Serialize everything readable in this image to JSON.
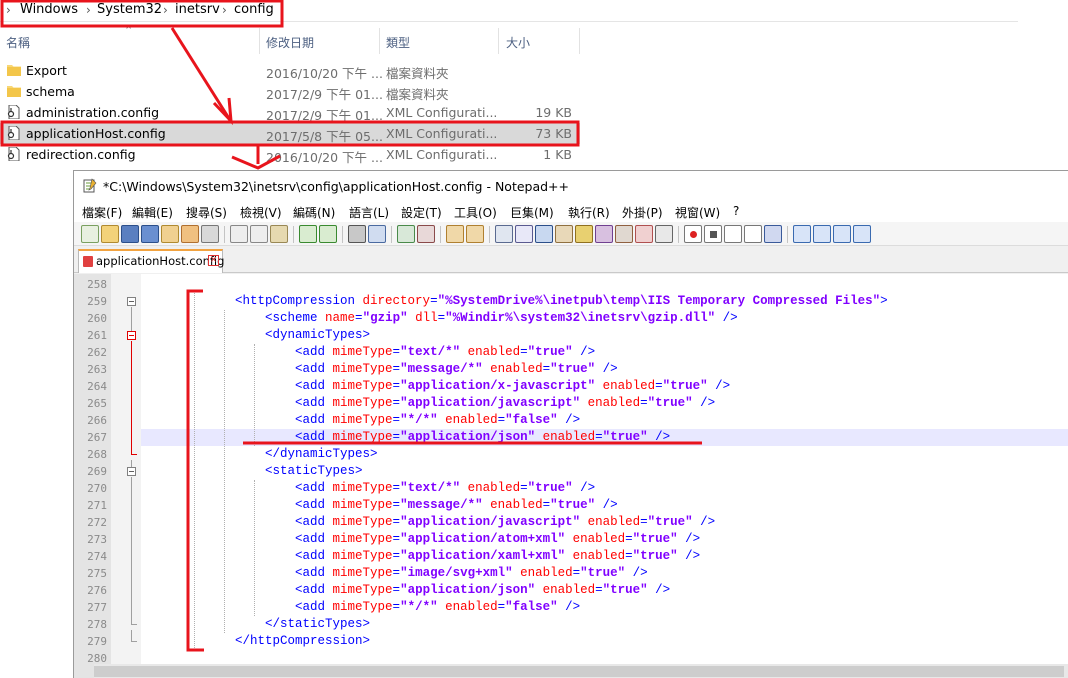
{
  "explorer": {
    "breadcrumb": [
      "Windows",
      "System32",
      "inetsrv",
      "config"
    ],
    "columns": {
      "name": "名稱",
      "date": "修改日期",
      "type": "類型",
      "size": "大小"
    },
    "files": [
      {
        "name": "Export",
        "date": "2016/10/20 下午 ...",
        "type": "檔案資料夾",
        "size": "",
        "icon": "folder-icon"
      },
      {
        "name": "schema",
        "date": "2017/2/9 下午 01...",
        "type": "檔案資料夾",
        "size": "",
        "icon": "folder-icon"
      },
      {
        "name": "administration.config",
        "date": "2017/2/9 下午 01...",
        "type": "XML Configurati...",
        "size": "19 KB",
        "icon": "config-file-icon"
      },
      {
        "name": "applicationHost.config",
        "date": "2017/5/8 下午 05...",
        "type": "XML Configurati...",
        "size": "73 KB",
        "icon": "config-file-icon",
        "selected": true
      },
      {
        "name": "redirection.config",
        "date": "2016/10/20 下午 ...",
        "type": "XML Configurati...",
        "size": "1 KB",
        "icon": "config-file-icon"
      }
    ]
  },
  "notepad": {
    "title": "*C:\\Windows\\System32\\inetsrv\\config\\applicationHost.config - Notepad++",
    "menu": [
      "檔案(F)",
      "編輯(E)",
      "搜尋(S)",
      "檢視(V)",
      "編碼(N)",
      "語言(L)",
      "設定(T)",
      "工具(O)",
      "巨集(M)",
      "執行(R)",
      "外掛(P)",
      "視窗(W)",
      "?"
    ],
    "tab": {
      "label": "applicationHost.config",
      "close": "☒"
    },
    "lines": [
      {
        "n": "258",
        "indent": "",
        "parts": []
      },
      {
        "n": "259",
        "indent": "    ",
        "parts": [
          [
            "t",
            "<httpCompression "
          ],
          [
            "a",
            "directory"
          ],
          [
            "t",
            "="
          ],
          [
            "v",
            "\"%SystemDrive%\\inetpub\\temp\\IIS Temporary Compressed Files\""
          ],
          [
            "t",
            ">"
          ]
        ]
      },
      {
        "n": "260",
        "indent": "        ",
        "parts": [
          [
            "t",
            "<scheme "
          ],
          [
            "a",
            "name"
          ],
          [
            "t",
            "="
          ],
          [
            "v",
            "\"gzip\""
          ],
          [
            "t",
            " "
          ],
          [
            "a",
            "dll"
          ],
          [
            "t",
            "="
          ],
          [
            "v",
            "\"%Windir%\\system32\\inetsrv\\gzip.dll\""
          ],
          [
            "t",
            " />"
          ]
        ]
      },
      {
        "n": "261",
        "indent": "        ",
        "parts": [
          [
            "t",
            "<dynamicTypes>"
          ]
        ]
      },
      {
        "n": "262",
        "indent": "            ",
        "parts": [
          [
            "t",
            "<add "
          ],
          [
            "a",
            "mimeType"
          ],
          [
            "t",
            "="
          ],
          [
            "v",
            "\"text/*\""
          ],
          [
            "t",
            " "
          ],
          [
            "a",
            "enabled"
          ],
          [
            "t",
            "="
          ],
          [
            "v",
            "\"true\""
          ],
          [
            "t",
            " />"
          ]
        ]
      },
      {
        "n": "263",
        "indent": "            ",
        "parts": [
          [
            "t",
            "<add "
          ],
          [
            "a",
            "mimeType"
          ],
          [
            "t",
            "="
          ],
          [
            "v",
            "\"message/*\""
          ],
          [
            "t",
            " "
          ],
          [
            "a",
            "enabled"
          ],
          [
            "t",
            "="
          ],
          [
            "v",
            "\"true\""
          ],
          [
            "t",
            " />"
          ]
        ]
      },
      {
        "n": "264",
        "indent": "            ",
        "parts": [
          [
            "t",
            "<add "
          ],
          [
            "a",
            "mimeType"
          ],
          [
            "t",
            "="
          ],
          [
            "v",
            "\"application/x-javascript\""
          ],
          [
            "t",
            " "
          ],
          [
            "a",
            "enabled"
          ],
          [
            "t",
            "="
          ],
          [
            "v",
            "\"true\""
          ],
          [
            "t",
            " />"
          ]
        ]
      },
      {
        "n": "265",
        "indent": "            ",
        "parts": [
          [
            "t",
            "<add "
          ],
          [
            "a",
            "mimeType"
          ],
          [
            "t",
            "="
          ],
          [
            "v",
            "\"application/javascript\""
          ],
          [
            "t",
            " "
          ],
          [
            "a",
            "enabled"
          ],
          [
            "t",
            "="
          ],
          [
            "v",
            "\"true\""
          ],
          [
            "t",
            " />"
          ]
        ]
      },
      {
        "n": "266",
        "indent": "            ",
        "parts": [
          [
            "t",
            "<add "
          ],
          [
            "a",
            "mimeType"
          ],
          [
            "t",
            "="
          ],
          [
            "v",
            "\"*/*\""
          ],
          [
            "t",
            " "
          ],
          [
            "a",
            "enabled"
          ],
          [
            "t",
            "="
          ],
          [
            "v",
            "\"false\""
          ],
          [
            "t",
            " />"
          ]
        ]
      },
      {
        "n": "267",
        "indent": "            ",
        "parts": [
          [
            "t",
            "<add "
          ],
          [
            "a",
            "mimeType"
          ],
          [
            "t",
            "="
          ],
          [
            "v",
            "\"application/json\""
          ],
          [
            "t",
            " "
          ],
          [
            "a",
            "enabled"
          ],
          [
            "t",
            "="
          ],
          [
            "v",
            "\"true\""
          ],
          [
            "t",
            " />"
          ]
        ]
      },
      {
        "n": "268",
        "indent": "        ",
        "parts": [
          [
            "t",
            "</dynamicTypes>"
          ]
        ]
      },
      {
        "n": "269",
        "indent": "        ",
        "parts": [
          [
            "t",
            "<staticTypes>"
          ]
        ]
      },
      {
        "n": "270",
        "indent": "            ",
        "parts": [
          [
            "t",
            "<add "
          ],
          [
            "a",
            "mimeType"
          ],
          [
            "t",
            "="
          ],
          [
            "v",
            "\"text/*\""
          ],
          [
            "t",
            " "
          ],
          [
            "a",
            "enabled"
          ],
          [
            "t",
            "="
          ],
          [
            "v",
            "\"true\""
          ],
          [
            "t",
            " />"
          ]
        ]
      },
      {
        "n": "271",
        "indent": "            ",
        "parts": [
          [
            "t",
            "<add "
          ],
          [
            "a",
            "mimeType"
          ],
          [
            "t",
            "="
          ],
          [
            "v",
            "\"message/*\""
          ],
          [
            "t",
            " "
          ],
          [
            "a",
            "enabled"
          ],
          [
            "t",
            "="
          ],
          [
            "v",
            "\"true\""
          ],
          [
            "t",
            " />"
          ]
        ]
      },
      {
        "n": "272",
        "indent": "            ",
        "parts": [
          [
            "t",
            "<add "
          ],
          [
            "a",
            "mimeType"
          ],
          [
            "t",
            "="
          ],
          [
            "v",
            "\"application/javascript\""
          ],
          [
            "t",
            " "
          ],
          [
            "a",
            "enabled"
          ],
          [
            "t",
            "="
          ],
          [
            "v",
            "\"true\""
          ],
          [
            "t",
            " />"
          ]
        ]
      },
      {
        "n": "273",
        "indent": "            ",
        "parts": [
          [
            "t",
            "<add "
          ],
          [
            "a",
            "mimeType"
          ],
          [
            "t",
            "="
          ],
          [
            "v",
            "\"application/atom+xml\""
          ],
          [
            "t",
            " "
          ],
          [
            "a",
            "enabled"
          ],
          [
            "t",
            "="
          ],
          [
            "v",
            "\"true\""
          ],
          [
            "t",
            " />"
          ]
        ]
      },
      {
        "n": "274",
        "indent": "            ",
        "parts": [
          [
            "t",
            "<add "
          ],
          [
            "a",
            "mimeType"
          ],
          [
            "t",
            "="
          ],
          [
            "v",
            "\"application/xaml+xml\""
          ],
          [
            "t",
            " "
          ],
          [
            "a",
            "enabled"
          ],
          [
            "t",
            "="
          ],
          [
            "v",
            "\"true\""
          ],
          [
            "t",
            " />"
          ]
        ]
      },
      {
        "n": "275",
        "indent": "            ",
        "parts": [
          [
            "t",
            "<add "
          ],
          [
            "a",
            "mimeType"
          ],
          [
            "t",
            "="
          ],
          [
            "v",
            "\"image/svg+xml\""
          ],
          [
            "t",
            " "
          ],
          [
            "a",
            "enabled"
          ],
          [
            "t",
            "="
          ],
          [
            "v",
            "\"true\""
          ],
          [
            "t",
            " />"
          ]
        ]
      },
      {
        "n": "276",
        "indent": "            ",
        "parts": [
          [
            "t",
            "<add "
          ],
          [
            "a",
            "mimeType"
          ],
          [
            "t",
            "="
          ],
          [
            "v",
            "\"application/json\""
          ],
          [
            "t",
            " "
          ],
          [
            "a",
            "enabled"
          ],
          [
            "t",
            "="
          ],
          [
            "v",
            "\"true\""
          ],
          [
            "t",
            " />"
          ]
        ]
      },
      {
        "n": "277",
        "indent": "            ",
        "parts": [
          [
            "t",
            "<add "
          ],
          [
            "a",
            "mimeType"
          ],
          [
            "t",
            "="
          ],
          [
            "v",
            "\"*/*\""
          ],
          [
            "t",
            " "
          ],
          [
            "a",
            "enabled"
          ],
          [
            "t",
            "="
          ],
          [
            "v",
            "\"false\""
          ],
          [
            "t",
            " />"
          ]
        ]
      },
      {
        "n": "278",
        "indent": "        ",
        "parts": [
          [
            "t",
            "</staticTypes>"
          ]
        ]
      },
      {
        "n": "279",
        "indent": "    ",
        "parts": [
          [
            "t",
            "</httpCompression>"
          ]
        ]
      },
      {
        "n": "280",
        "indent": "",
        "parts": []
      }
    ]
  },
  "colors": {
    "annotation": "#e8141c",
    "tag": "#0000ff",
    "attr": "#ff0000",
    "value": "#8000ff",
    "caret_line": "#e8e8ff"
  }
}
